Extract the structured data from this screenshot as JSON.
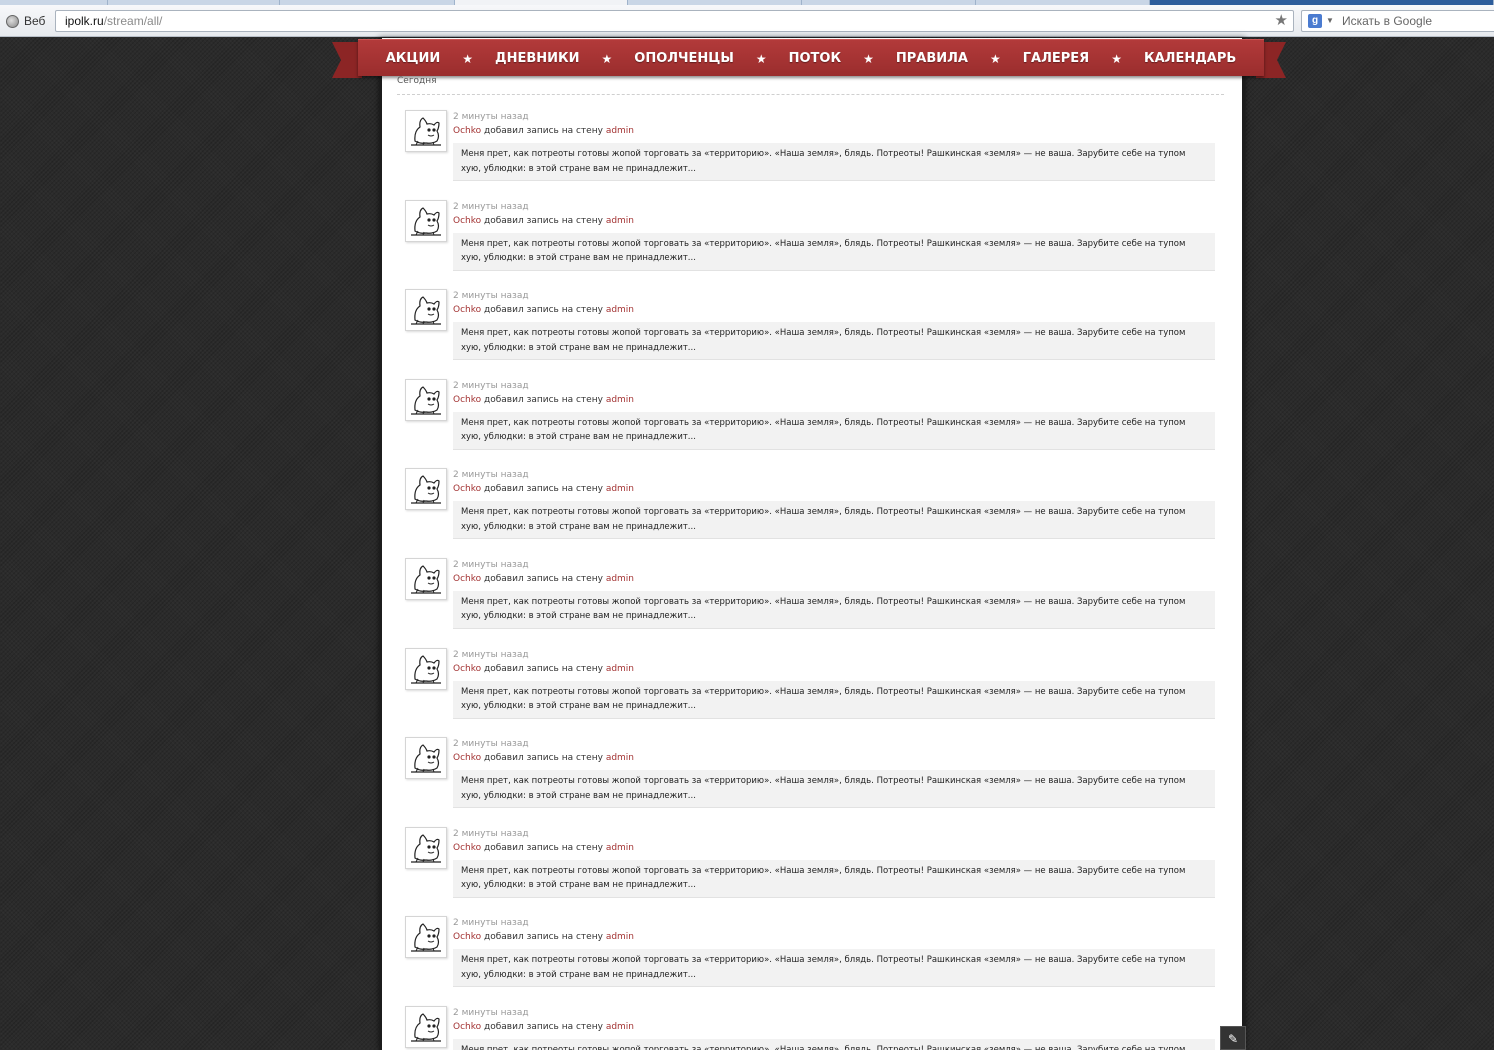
{
  "browser": {
    "mode_label": "Веб",
    "url_domain": "ipolk.ru",
    "url_path": "/stream/all/",
    "search_placeholder": "Искать в Google",
    "search_engine_letter": "g"
  },
  "nav": {
    "items": [
      "АКЦИИ",
      "ДНЕВНИКИ",
      "ОПОЛЧЕНЦЫ",
      "ПОТОК",
      "ПРАВИЛА",
      "ГАЛЕРЕЯ",
      "КАЛЕНДАРЬ"
    ],
    "separator": "★",
    "color": "#a83333"
  },
  "feed": {
    "day_label": "Сегодня",
    "items": [
      {
        "time": "2 минуты назад",
        "user": "Ochko",
        "action": "добавил запись на стену",
        "target": "admin",
        "text": "Меня прет, как потреоты готовы жопой торговать за «территорию». «Наша земля», блядь. Потреоты! Рашкинская «земля» — не ваша. Зарубите себе на тупом хую, ублюдки: в этой стране вам не принадлежит..."
      },
      {
        "time": "2 минуты назад",
        "user": "Ochko",
        "action": "добавил запись на стену",
        "target": "admin",
        "text": "Меня прет, как потреоты готовы жопой торговать за «территорию». «Наша земля», блядь. Потреоты! Рашкинская «земля» — не ваша. Зарубите себе на тупом хую, ублюдки: в этой стране вам не принадлежит..."
      },
      {
        "time": "2 минуты назад",
        "user": "Ochko",
        "action": "добавил запись на стену",
        "target": "admin",
        "text": "Меня прет, как потреоты готовы жопой торговать за «территорию». «Наша земля», блядь. Потреоты! Рашкинская «земля» — не ваша. Зарубите себе на тупом хую, ублюдки: в этой стране вам не принадлежит..."
      },
      {
        "time": "2 минуты назад",
        "user": "Ochko",
        "action": "добавил запись на стену",
        "target": "admin",
        "text": "Меня прет, как потреоты готовы жопой торговать за «территорию». «Наша земля», блядь. Потреоты! Рашкинская «земля» — не ваша. Зарубите себе на тупом хую, ублюдки: в этой стране вам не принадлежит..."
      },
      {
        "time": "2 минуты назад",
        "user": "Ochko",
        "action": "добавил запись на стену",
        "target": "admin",
        "text": "Меня прет, как потреоты готовы жопой торговать за «территорию». «Наша земля», блядь. Потреоты! Рашкинская «земля» — не ваша. Зарубите себе на тупом хую, ублюдки: в этой стране вам не принадлежит..."
      },
      {
        "time": "2 минуты назад",
        "user": "Ochko",
        "action": "добавил запись на стену",
        "target": "admin",
        "text": "Меня прет, как потреоты готовы жопой торговать за «территорию». «Наша земля», блядь. Потреоты! Рашкинская «земля» — не ваша. Зарубите себе на тупом хую, ублюдки: в этой стране вам не принадлежит..."
      },
      {
        "time": "2 минуты назад",
        "user": "Ochko",
        "action": "добавил запись на стену",
        "target": "admin",
        "text": "Меня прет, как потреоты готовы жопой торговать за «территорию». «Наша земля», блядь. Потреоты! Рашкинская «земля» — не ваша. Зарубите себе на тупом хую, ублюдки: в этой стране вам не принадлежит..."
      },
      {
        "time": "2 минуты назад",
        "user": "Ochko",
        "action": "добавил запись на стену",
        "target": "admin",
        "text": "Меня прет, как потреоты готовы жопой торговать за «территорию». «Наша земля», блядь. Потреоты! Рашкинская «земля» — не ваша. Зарубите себе на тупом хую, ублюдки: в этой стране вам не принадлежит..."
      },
      {
        "time": "2 минуты назад",
        "user": "Ochko",
        "action": "добавил запись на стену",
        "target": "admin",
        "text": "Меня прет, как потреоты готовы жопой торговать за «территорию». «Наша земля», блядь. Потреоты! Рашкинская «земля» — не ваша. Зарубите себе на тупом хую, ублюдки: в этой стране вам не принадлежит..."
      },
      {
        "time": "2 минуты назад",
        "user": "Ochko",
        "action": "добавил запись на стену",
        "target": "admin",
        "text": "Меня прет, как потреоты готовы жопой торговать за «территорию». «Наша земля», блядь. Потреоты! Рашкинская «земля» — не ваша. Зарубите себе на тупом хую, ублюдки: в этой стране вам не принадлежит..."
      },
      {
        "time": "2 минуты назад",
        "user": "Ochko",
        "action": "добавил запись на стену",
        "target": "admin",
        "text": "Меня прет, как потреоты готовы жопой торговать за «территорию». «Наша земля», блядь. Потреоты! Рашкинская «земля» — не ваша. Зарубите себе на тупом хую, ублюдки: в этой стране вам не принадлежит..."
      }
    ]
  }
}
